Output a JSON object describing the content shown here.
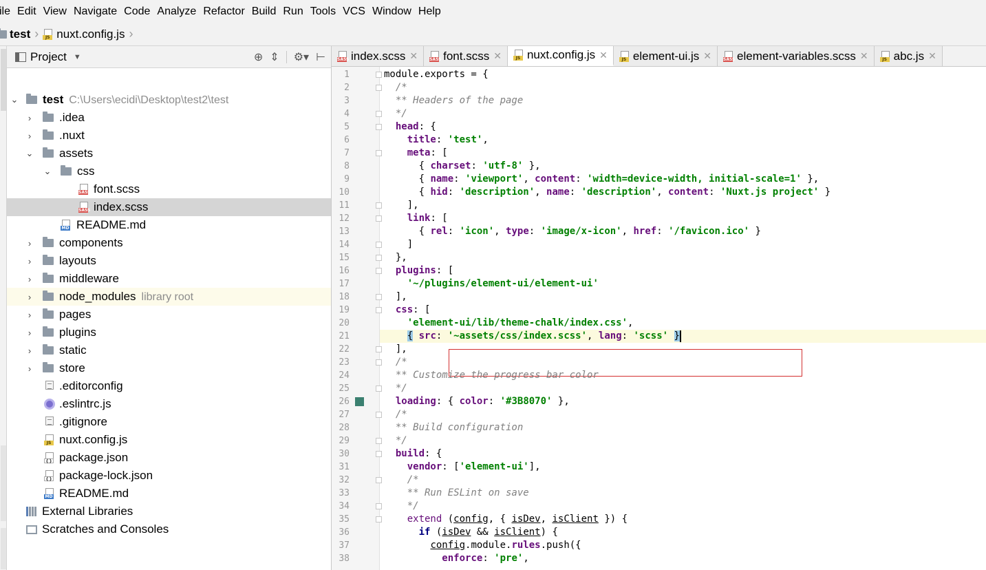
{
  "menubar": {
    "items": [
      "ile",
      "Edit",
      "View",
      "Navigate",
      "Code",
      "Analyze",
      "Refactor",
      "Build",
      "Run",
      "Tools",
      "VCS",
      "Window",
      "Help"
    ]
  },
  "navbar": {
    "project": "test",
    "file": "nuxt.config.js"
  },
  "panel": {
    "title": "Project"
  },
  "tree": {
    "root": {
      "label": "test",
      "path": "C:\\Users\\ecidi\\Desktop\\test2\\test"
    },
    "items": [
      {
        "label": ".idea"
      },
      {
        "label": ".nuxt"
      },
      {
        "label": "assets"
      },
      {
        "label": "css"
      },
      {
        "label": "font.scss"
      },
      {
        "label": "index.scss"
      },
      {
        "label": "README.md"
      },
      {
        "label": "components"
      },
      {
        "label": "layouts"
      },
      {
        "label": "middleware"
      },
      {
        "label": "node_modules",
        "hint": "library root"
      },
      {
        "label": "pages"
      },
      {
        "label": "plugins"
      },
      {
        "label": "static"
      },
      {
        "label": "store"
      },
      {
        "label": ".editorconfig"
      },
      {
        "label": ".eslintrc.js"
      },
      {
        "label": ".gitignore"
      },
      {
        "label": "nuxt.config.js"
      },
      {
        "label": "package.json"
      },
      {
        "label": "package-lock.json"
      },
      {
        "label": "README.md"
      },
      {
        "label": "External Libraries"
      },
      {
        "label": "Scratches and Consoles"
      }
    ]
  },
  "tabs": [
    {
      "label": "index.scss",
      "icon": "sass-file-icon"
    },
    {
      "label": "font.scss",
      "icon": "sass-file-icon"
    },
    {
      "label": "nuxt.config.js",
      "icon": "js-file-icon",
      "active": true
    },
    {
      "label": "element-ui.js",
      "icon": "js-file-icon"
    },
    {
      "label": "element-variables.scss",
      "icon": "sass-file-icon"
    },
    {
      "label": "abc.js",
      "icon": "js-file-icon"
    }
  ],
  "editor": {
    "caret_line": 21,
    "bookmark_color": "#3B8070",
    "line_numbers": [
      "1",
      "2",
      "3",
      "4",
      "5",
      "6",
      "7",
      "8",
      "9",
      "10",
      "11",
      "12",
      "13",
      "14",
      "15",
      "16",
      "17",
      "18",
      "19",
      "20",
      "21",
      "22",
      "23",
      "24",
      "25",
      "26",
      "27",
      "28",
      "29",
      "30",
      "31",
      "32",
      "33",
      "34",
      "35",
      "36",
      "37",
      "38"
    ],
    "lines": [
      "module.exports = {",
      "  /*",
      "  ** Headers of the page",
      "  */",
      "  head: {",
      "    title: 'test',",
      "    meta: [",
      "      { charset: 'utf-8' },",
      "      { name: 'viewport', content: 'width=device-width, initial-scale=1' },",
      "      { hid: 'description', name: 'description', content: 'Nuxt.js project' }",
      "    ],",
      "    link: [",
      "      { rel: 'icon', type: 'image/x-icon', href: '/favicon.ico' }",
      "    ]",
      "  },",
      "  plugins: [",
      "    '~/plugins/element-ui/element-ui'",
      "  ],",
      "  css: [",
      "    'element-ui/lib/theme-chalk/index.css',",
      "    { src: '~assets/css/index.scss', lang: 'scss' }",
      "  ],",
      "  /*",
      "  ** Customize the progress bar color",
      "  */",
      "  loading: { color: '#3B8070' },",
      "  /*",
      "  ** Build configuration",
      "  */",
      "  build: {",
      "    vendor: ['element-ui'],",
      "    /*",
      "    ** Run ESLint on save",
      "    */",
      "    extend (config, { isDev, isClient }) {",
      "      if (isDev && isClient) {",
      "        config.module.rules.push({",
      "          enforce: 'pre',"
    ]
  }
}
